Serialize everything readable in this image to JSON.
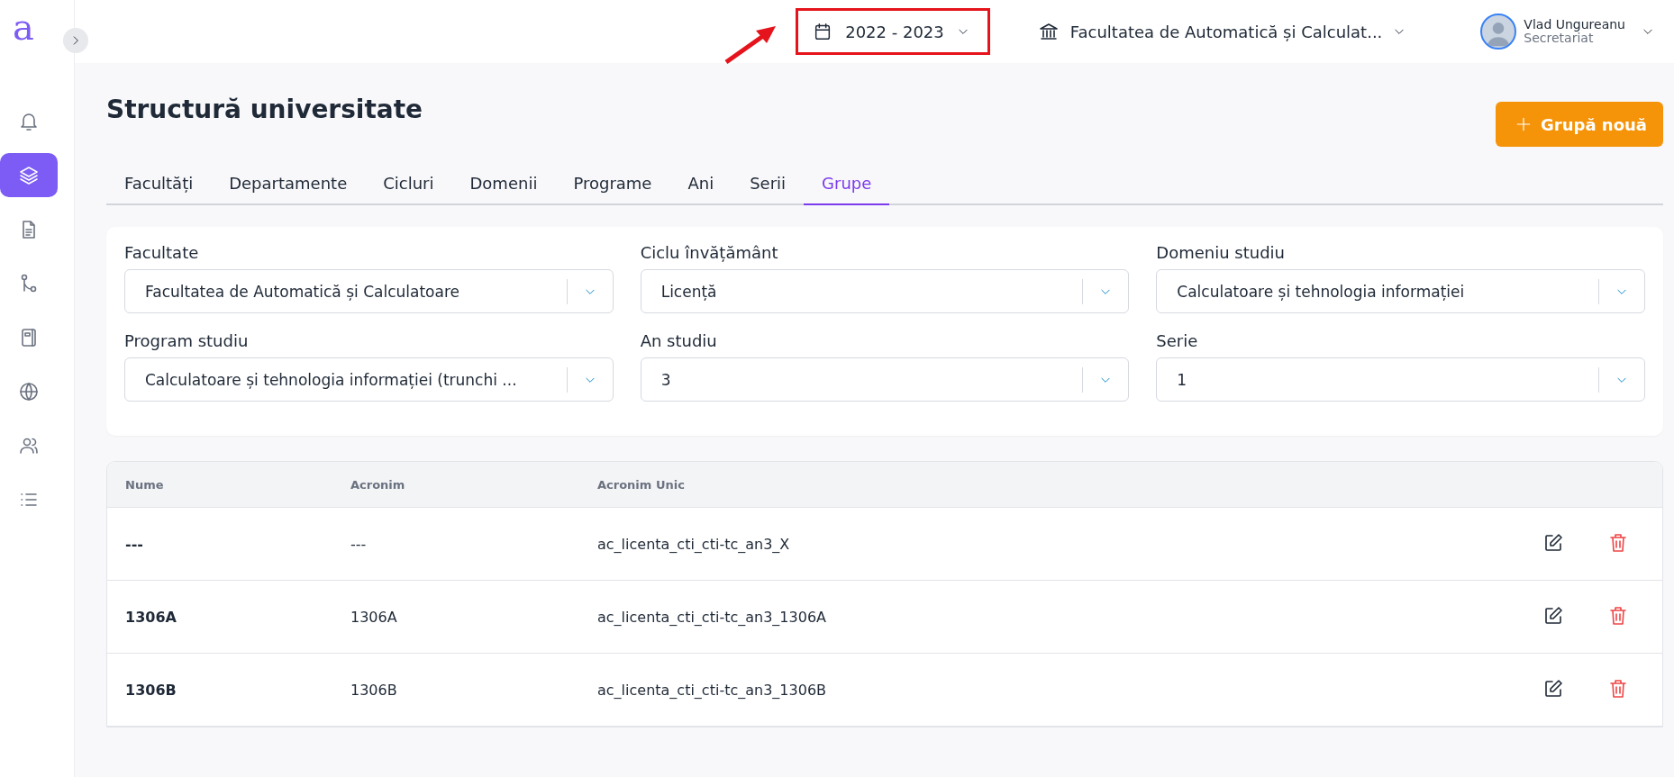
{
  "logo": "a",
  "sidebar": {
    "items": [
      {
        "kind": "bell",
        "selected": false
      },
      {
        "kind": "layers",
        "selected": true
      },
      {
        "kind": "document",
        "selected": false
      },
      {
        "kind": "branch",
        "selected": false
      },
      {
        "kind": "book",
        "selected": false
      },
      {
        "kind": "globe",
        "selected": false
      },
      {
        "kind": "users",
        "selected": false
      },
      {
        "kind": "list",
        "selected": false
      }
    ]
  },
  "topbar": {
    "year_selector": {
      "value": "2022 - 2023",
      "highlighted": true
    },
    "faculty_selector": {
      "value": "Facultatea de Automatică și Calculat..."
    },
    "user": {
      "name": "Vlad Ungureanu",
      "role": "Secretariat"
    }
  },
  "page": {
    "title": "Structură universitate",
    "new_button": "Grupă nouă"
  },
  "tabs": [
    {
      "label": "Facultăți",
      "selected": false
    },
    {
      "label": "Departamente",
      "selected": false
    },
    {
      "label": "Cicluri",
      "selected": false
    },
    {
      "label": "Domenii",
      "selected": false
    },
    {
      "label": "Programe",
      "selected": false
    },
    {
      "label": "Ani",
      "selected": false
    },
    {
      "label": "Serii",
      "selected": false
    },
    {
      "label": "Grupe",
      "selected": true
    }
  ],
  "filters": [
    {
      "label": "Facultate",
      "value": "Facultatea de Automatică și Calculatoare"
    },
    {
      "label": "Ciclu învățământ",
      "value": "Licență"
    },
    {
      "label": "Domeniu studiu",
      "value": "Calculatoare și tehnologia informației"
    },
    {
      "label": "Program studiu",
      "value": "Calculatoare și tehnologia informației (trunchi ..."
    },
    {
      "label": "An studiu",
      "value": "3"
    },
    {
      "label": "Serie",
      "value": "1"
    }
  ],
  "table": {
    "columns": [
      "Nume",
      "Acronim",
      "Acronim Unic"
    ],
    "rows": [
      {
        "cells": [
          "---",
          "---",
          "ac_licenta_cti_cti-tc_an3_X"
        ]
      },
      {
        "cells": [
          "1306A",
          "1306A",
          "ac_licenta_cti_cti-tc_an3_1306A"
        ]
      },
      {
        "cells": [
          "1306B",
          "1306B",
          "ac_licenta_cti_cti-tc_an3_1306B"
        ]
      }
    ]
  }
}
